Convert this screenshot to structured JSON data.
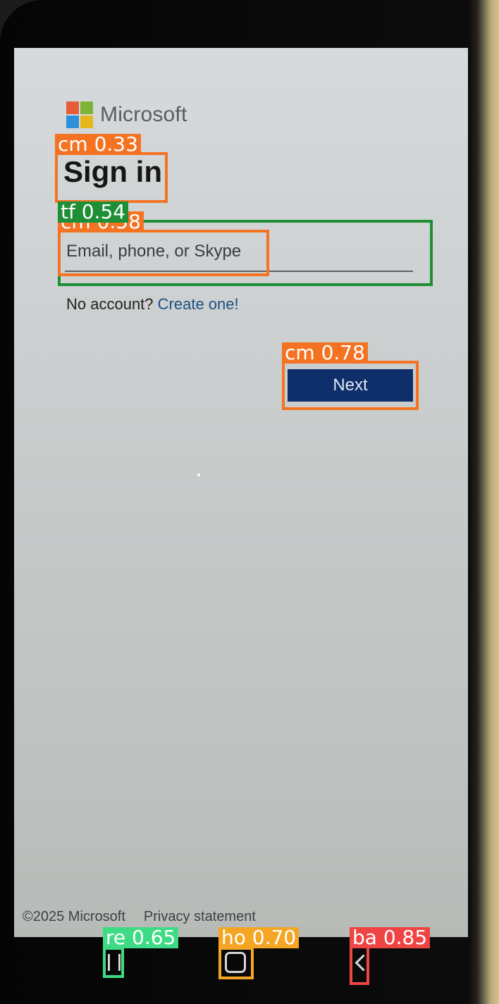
{
  "brand": {
    "name": "Microsoft"
  },
  "form": {
    "title": "Sign in",
    "email_placeholder": "Email, phone, or Skype",
    "no_account_text": "No account?",
    "create_link": "Create one!",
    "next_label": "Next"
  },
  "footer": {
    "copyright": "©2025 Microsoft",
    "privacy": "Privacy statement"
  },
  "navbar": {
    "recent_icon": "recent-apps-icon",
    "home_icon": "home-icon",
    "back_icon": "back-icon"
  },
  "detections": [
    {
      "label": "cm 0.33",
      "color": "#f47323"
    },
    {
      "label": "cm 0.58",
      "color": "#f47323"
    },
    {
      "label": "tf 0.54",
      "color": "#1f8f36"
    },
    {
      "label": "cm 0.78",
      "color": "#f47323"
    },
    {
      "label": "re 0.65",
      "color": "#3ddc84"
    },
    {
      "label": "ho 0.70",
      "color": "#f5a524"
    },
    {
      "label": "ba 0.85",
      "color": "#ef4444"
    }
  ]
}
